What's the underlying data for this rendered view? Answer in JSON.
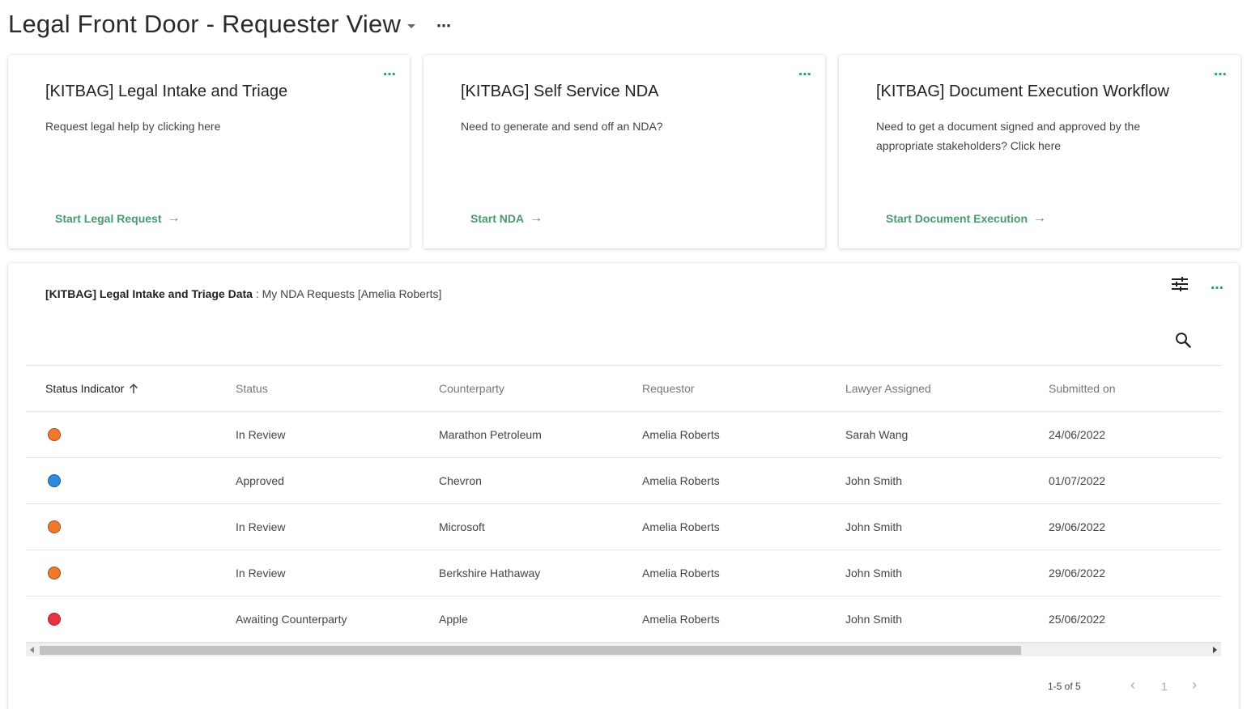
{
  "header": {
    "title": "Legal Front Door - Requester View",
    "more": "⋯"
  },
  "cards": [
    {
      "title": "[KITBAG] Legal Intake and Triage",
      "description": "Request legal help by clicking here",
      "link": "Start Legal Request",
      "arrow": "→"
    },
    {
      "title": "[KITBAG] Self Service NDA",
      "description": "Need to generate and send off an NDA?",
      "link": "Start NDA",
      "arrow": "→"
    },
    {
      "title": "[KITBAG] Document Execution Workflow",
      "description": "Need to get a document signed and approved by the appropriate stakeholders? Click here",
      "link": "Start Document Execution",
      "arrow": "→"
    }
  ],
  "panel": {
    "heading_bold": "[KITBAG] Legal Intake and Triage Data",
    "heading_rest": " : My NDA Requests [Amelia Roberts]",
    "more": "⋯",
    "icons": {
      "filter": "tune-icon",
      "search": "search-icon"
    }
  },
  "table": {
    "columns": [
      "Status Indicator",
      "Status",
      "Counterparty",
      "Requestor",
      "Lawyer Assigned",
      "Submitted on"
    ],
    "sort_icon": "arrow-up-icon",
    "rows": [
      {
        "indicator_color": "#f07a2a",
        "status": "In Review",
        "counterparty": "Marathon Petroleum",
        "requestor": "Amelia Roberts",
        "lawyer": "Sarah Wang",
        "submitted": "24/06/2022"
      },
      {
        "indicator_color": "#2a8be0",
        "status": "Approved",
        "counterparty": "Chevron",
        "requestor": "Amelia Roberts",
        "lawyer": "John Smith",
        "submitted": "01/07/2022"
      },
      {
        "indicator_color": "#f07a2a",
        "status": "In Review",
        "counterparty": "Microsoft",
        "requestor": "Amelia Roberts",
        "lawyer": "John Smith",
        "submitted": "29/06/2022"
      },
      {
        "indicator_color": "#f07a2a",
        "status": "In Review",
        "counterparty": "Berkshire Hathaway",
        "requestor": "Amelia Roberts",
        "lawyer": "John Smith",
        "submitted": "29/06/2022"
      },
      {
        "indicator_color": "#e8333f",
        "status": "Awaiting Counterparty",
        "counterparty": "Apple",
        "requestor": "Amelia Roberts",
        "lawyer": "John Smith",
        "submitted": "25/06/2022"
      }
    ]
  },
  "pagination": {
    "count": "1-5 of 5",
    "page": "1",
    "prev": "‹",
    "next": "›"
  },
  "colors": {
    "accent": "#4a9a6e"
  }
}
